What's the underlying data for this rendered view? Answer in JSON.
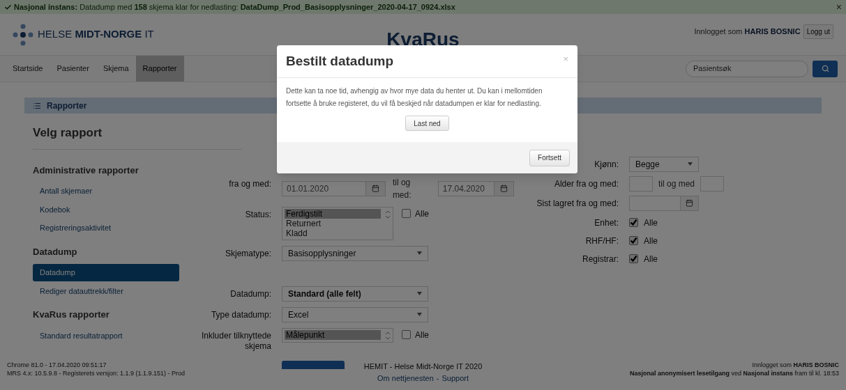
{
  "notice": {
    "text": "**Nasjonal instans:** Datadump med **158** skjema klar for nedlasting: **DataDump_Prod_Basisopplysninger_2020-04-17_0924.xlsx**",
    "close": "×"
  },
  "header": {
    "logo_light": "HELSE",
    "logo_bold": "MIDT-NORGE",
    "logo_suffix": "IT",
    "title": "KvaRus",
    "user_prefix": "Innlogget som",
    "user": "HARIS BOSNIC",
    "logout": "Logg ut"
  },
  "nav": {
    "tabs": [
      {
        "label": "Startside",
        "selected": false
      },
      {
        "label": "Pasienter",
        "selected": false
      },
      {
        "label": "Skjema",
        "selected": false
      },
      {
        "label": "Rapporter",
        "selected": true
      }
    ],
    "search": {
      "placeholder": "Pasientsøk"
    }
  },
  "panel_title": "Rapporter",
  "heading": "Velg rapport",
  "sidebar": [
    {
      "heading": "Administrative rapporter",
      "items": [
        {
          "label": "Antall skjemaer",
          "selected": false
        },
        {
          "label": "Kodebok",
          "selected": false
        },
        {
          "label": "Registreringsaktivitet",
          "selected": false
        }
      ]
    },
    {
      "heading": "Datadump",
      "items": [
        {
          "label": "Datadump",
          "selected": true
        },
        {
          "label": "Rediger datauttrekk/filter",
          "selected": false
        }
      ]
    },
    {
      "heading": "KvaRus rapporter",
      "items": [
        {
          "label": "Standard resultatrapport",
          "selected": false
        }
      ]
    }
  ],
  "filters": [
    {
      "kind": "date_range",
      "label": "fra og med:",
      "from": "01.01.2020",
      "to_label": "til og med:",
      "to": "17.04.2020"
    },
    {
      "kind": "listbox",
      "label": "Status:",
      "options": [
        {
          "label": "Ferdigstilt",
          "selected": true
        },
        {
          "label": "Returnert",
          "selected": false
        },
        {
          "label": "Kladd",
          "selected": false
        }
      ],
      "all_label": "Alle",
      "all_checked": false
    },
    {
      "kind": "select",
      "label": "Skjematype:",
      "value": "Basisopplysninger",
      "bold": false
    }
  ],
  "export": [
    {
      "kind": "select",
      "label": "Datadump:",
      "value": "Standard (alle felt)",
      "bold": true
    },
    {
      "kind": "select",
      "label": "Type datadump:",
      "value": "Excel",
      "bold": false
    },
    {
      "kind": "listbox",
      "label": "Inkluder tilknyttede skjema",
      "options": [
        {
          "label": "Målepunkt",
          "selected": true
        }
      ],
      "all_label": "Alle",
      "all_checked": false
    }
  ],
  "filters_right": [
    {
      "kind": "select",
      "label": "Kjønn:",
      "value": "Begge",
      "bold": false
    },
    {
      "kind": "range",
      "label": "Alder fra og med:",
      "to_label": "til og med"
    },
    {
      "kind": "date",
      "label": "Sist lagret fra og med:"
    },
    {
      "kind": "check",
      "label": "Enhet:",
      "check_label": "Alle",
      "checked": true
    },
    {
      "kind": "check",
      "label": "RHF/HF:",
      "check_label": "Alle",
      "checked": true
    },
    {
      "kind": "check",
      "label": "Registrar:",
      "check_label": "Alle",
      "checked": true
    }
  ],
  "footer": {
    "left": [
      "Chrome 81.0 - 17.04.2020 09:51:17",
      "MRS 4.x: 10.5.9.8 - Registerets versjon: 1.1.9 (1.1.9.151) - Prod"
    ],
    "center": "HEMIT - Helse Midt-Norge IT 2020",
    "links": [
      "Om nettjenesten",
      "Support"
    ],
    "link_separator": "-",
    "right": [
      "Innlogget som **HARIS BOSNIC**",
      "**Nasjonal anonymisert lesetilgang** ved **Nasjonal instans** fram til kl. 18:53"
    ]
  },
  "modal": {
    "title": "Bestilt datadump",
    "close": "×",
    "body": "Dette kan ta noe tid, avhengig av hvor mye data du henter ut. Du kan i mellomtiden fortsette å bruke registeret, du vil få beskjed når datadumpen er klar for nedlasting.",
    "download": "Last ned",
    "continue": "Fortsett"
  }
}
